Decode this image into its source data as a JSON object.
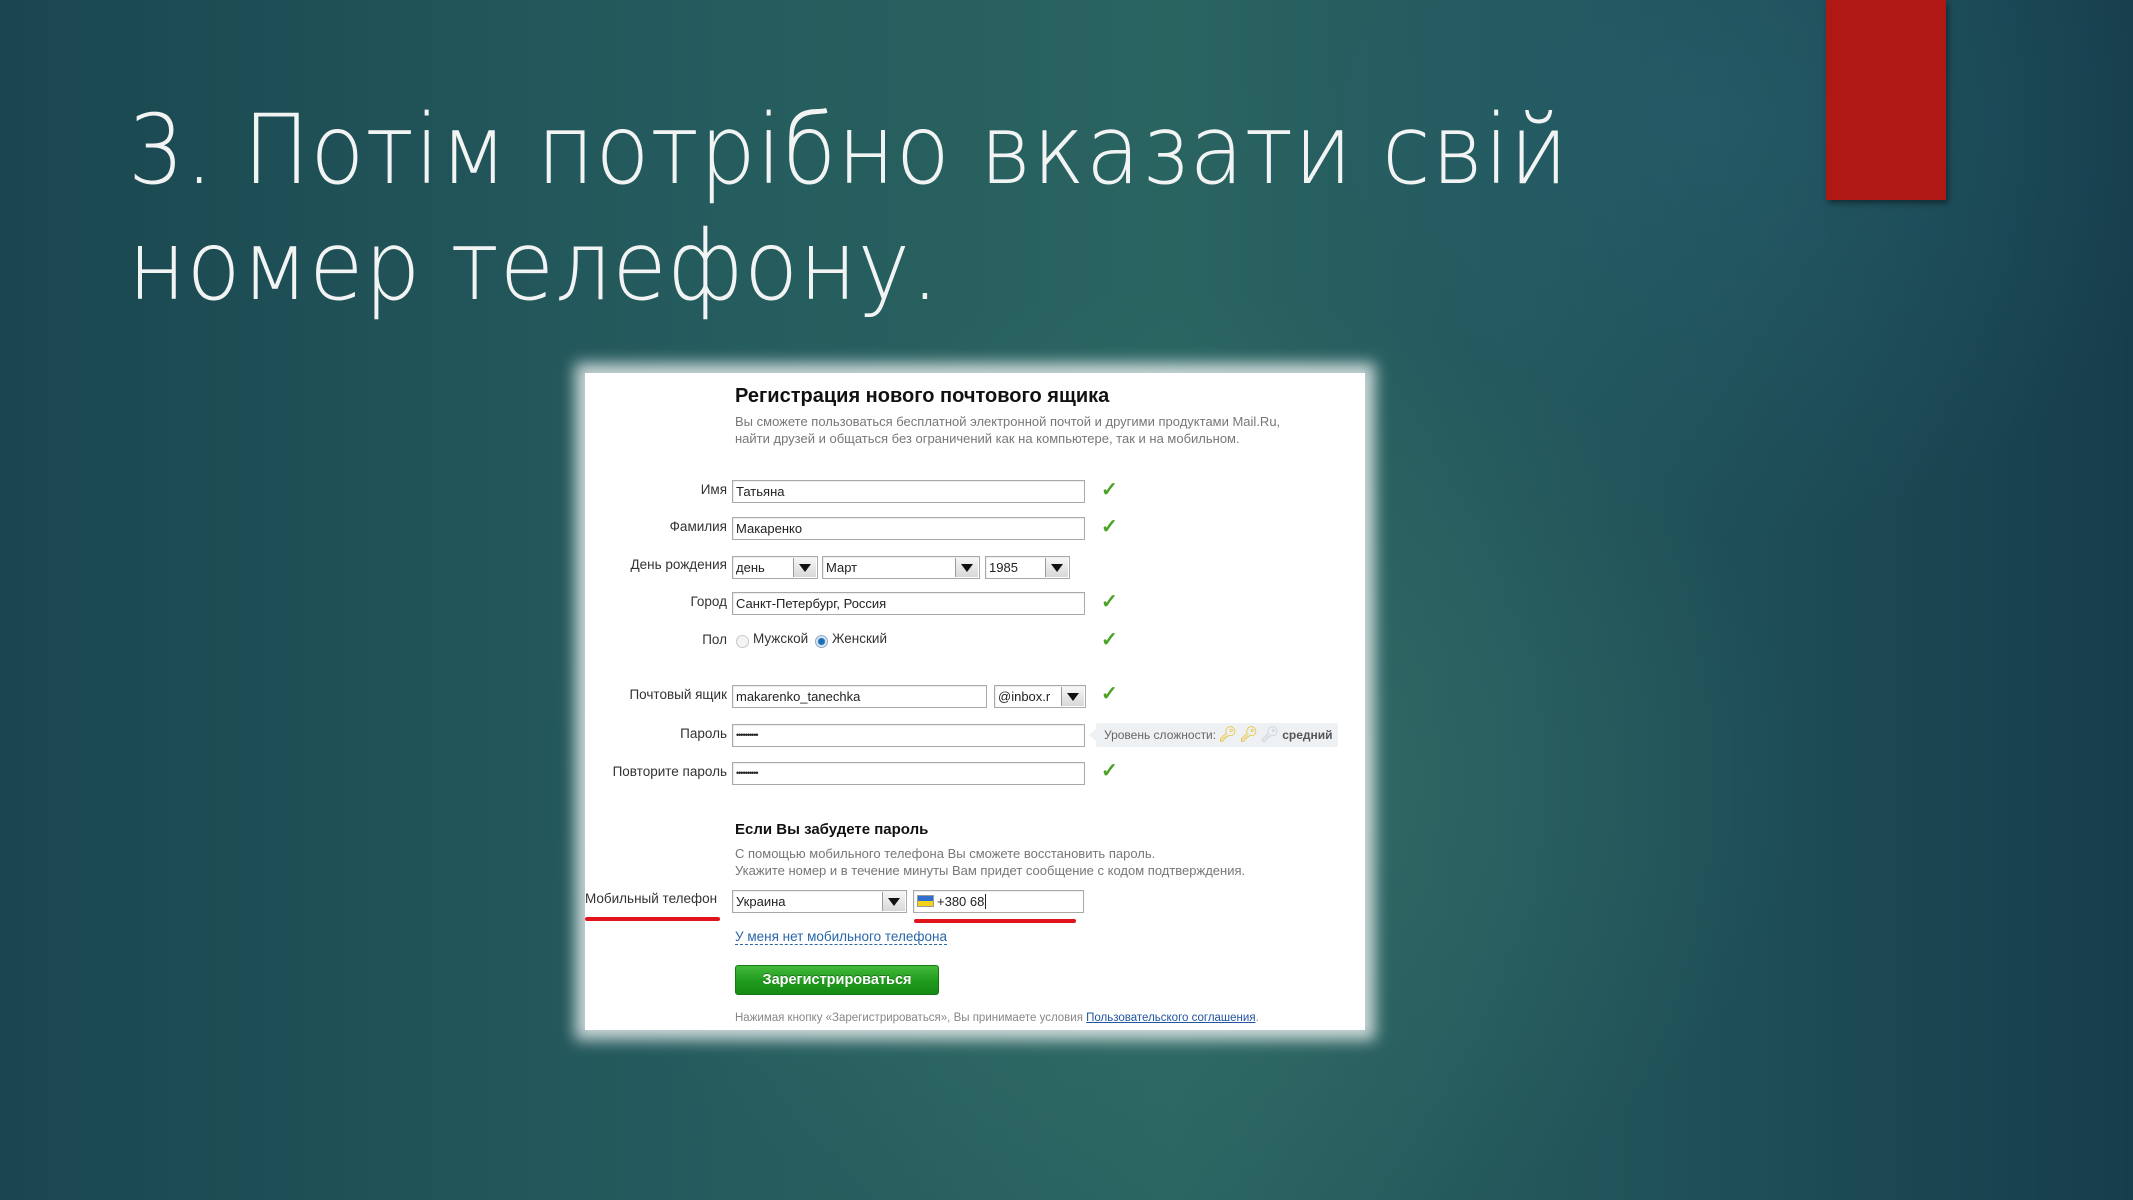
{
  "slide": {
    "title_lines": [
      "3. Потім потрібно вказати свій",
      "номер телефону."
    ],
    "accent_color": "#b01816"
  },
  "form": {
    "heading": "Регистрация нового почтового ящика",
    "intro_lines": [
      "Вы сможете пользоваться бесплатной электронной почтой и другими продуктами Mail.Ru,",
      "найти друзей и общаться без ограничений как на компьютере, так и на мобильном."
    ],
    "fields": {
      "first_name": {
        "label": "Имя",
        "value": "Татьяна",
        "valid": true
      },
      "last_name": {
        "label": "Фамилия",
        "value": "Макаренко",
        "valid": true
      },
      "birthday": {
        "label": "День рождения",
        "day": "день",
        "month": "Март",
        "year": "1985"
      },
      "city": {
        "label": "Город",
        "value": "Санкт-Петербург, Россия",
        "valid": true
      },
      "gender": {
        "label": "Пол",
        "options": [
          "Мужской",
          "Женский"
        ],
        "selected": "Женский",
        "valid": true
      },
      "mailbox": {
        "label": "Почтовый ящик",
        "value": "makarenko_tanechka",
        "domain": "@inbox.r",
        "valid": true
      },
      "password": {
        "label": "Пароль",
        "value": "••••••••••",
        "strength_label": "Уровень сложности:",
        "strength_level": 2,
        "strength_max": 3,
        "strength_text": "средний"
      },
      "password_repeat": {
        "label": "Повторите пароль",
        "value": "••••••••••",
        "valid": true
      }
    },
    "recovery": {
      "heading": "Если Вы забудете пароль",
      "text_lines": [
        "С помощью мобильного телефона Вы сможете восстановить пароль.",
        "Укажите номер и в течение минуты Вам придет сообщение с кодом подтверждения."
      ],
      "phone_label": "Мобильный телефон",
      "country": "Украина",
      "phone_value": "+380 68",
      "no_phone_link": "У меня нет мобильного телефона"
    },
    "register_button": "Зарегистрироваться",
    "terms_prefix": "Нажимая кнопку «Зарегистрироваться», Вы принимаете условия ",
    "terms_link": "Пользовательского соглашения",
    "terms_suffix": ".",
    "colors": {
      "check": "#4aa326",
      "button": "#1f9a1c",
      "highlight": "#e0141a",
      "link": "#2866a8"
    }
  }
}
